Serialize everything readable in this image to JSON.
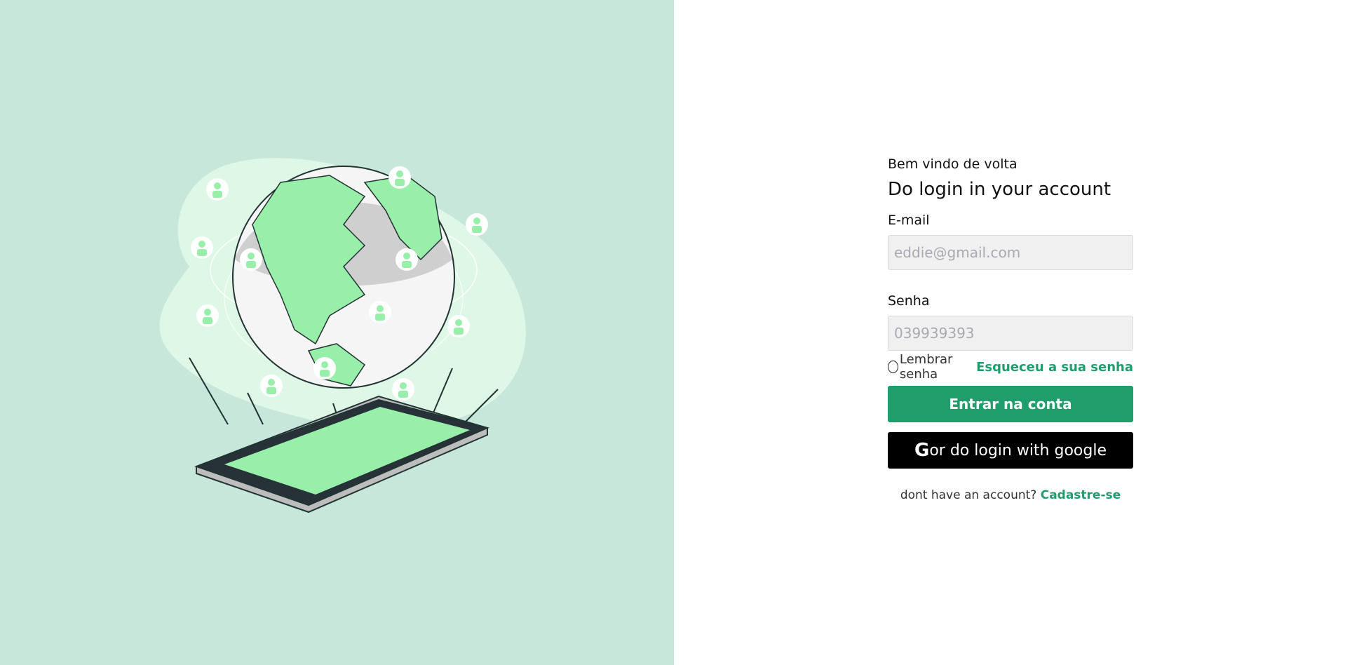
{
  "colors": {
    "left_background": "#c6e7da",
    "accent_green": "#1f9e6c",
    "illustration_green": "#98efaa",
    "google_button": "#000000"
  },
  "illustration": {
    "icon": "globe-phone-network-illustration"
  },
  "login": {
    "welcome": "Bem vindo de volta",
    "title": "Do login in your account",
    "email_label": "E-mail",
    "email_placeholder": "eddie@gmail.com",
    "email_value": "",
    "password_label": "Senha",
    "password_placeholder": "039939393",
    "password_value": "",
    "remember_label": "Lembrar senha",
    "remember_checked": false,
    "forgot_label": "Esqueceu a sua senha",
    "submit_label": "Entrar na conta",
    "google_icon_text": "G",
    "google_label": "or do login with google",
    "signup_prompt": "dont have an account?",
    "signup_link": "Cadastre-se"
  }
}
